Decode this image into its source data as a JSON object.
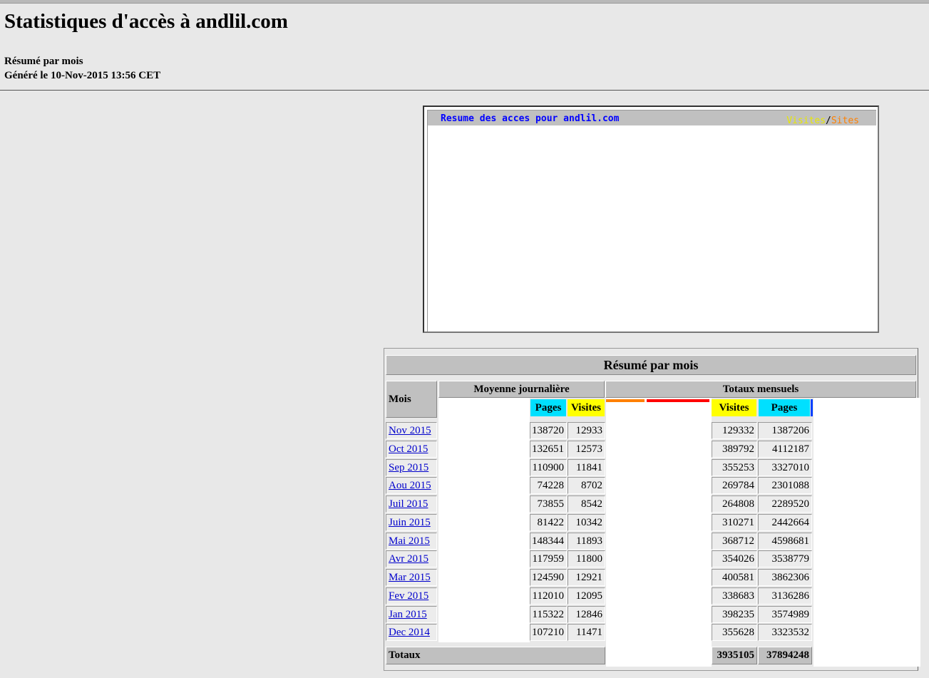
{
  "page": {
    "title": "Statistiques d'accès à andlil.com",
    "subtitle": "Résumé par mois",
    "generated": "Généré le 10-Nov-2015 13:56 CET"
  },
  "graph": {
    "title": "Resume des acces pour andlil.com",
    "legend_visits": "Visites",
    "legend_sep": "/",
    "legend_sites": "Sites"
  },
  "table": {
    "caption": "Résumé par mois",
    "col_month": "Mois",
    "group_daily": "Moyenne journalière",
    "group_monthly": "Totaux mensuels",
    "daily_pages": "Pages",
    "daily_visits": "Visites",
    "monthly_visits": "Visites",
    "monthly_pages": "Pages",
    "totals_label": "Totaux",
    "totals_visits": "3935105",
    "totals_pages": "37894248",
    "rows": [
      {
        "month": "Nov 2015",
        "d_pages": "138720",
        "d_visits": "12933",
        "m_visits": "129332",
        "m_pages": "1387206"
      },
      {
        "month": "Oct 2015",
        "d_pages": "132651",
        "d_visits": "12573",
        "m_visits": "389792",
        "m_pages": "4112187"
      },
      {
        "month": "Sep 2015",
        "d_pages": "110900",
        "d_visits": "11841",
        "m_visits": "355253",
        "m_pages": "3327010"
      },
      {
        "month": "Aou 2015",
        "d_pages": "74228",
        "d_visits": "8702",
        "m_visits": "269784",
        "m_pages": "2301088"
      },
      {
        "month": "Juil 2015",
        "d_pages": "73855",
        "d_visits": "8542",
        "m_visits": "264808",
        "m_pages": "2289520"
      },
      {
        "month": "Juin 2015",
        "d_pages": "81422",
        "d_visits": "10342",
        "m_visits": "310271",
        "m_pages": "2442664"
      },
      {
        "month": "Mai 2015",
        "d_pages": "148344",
        "d_visits": "11893",
        "m_visits": "368712",
        "m_pages": "4598681"
      },
      {
        "month": "Avr 2015",
        "d_pages": "117959",
        "d_visits": "11800",
        "m_visits": "354026",
        "m_pages": "3538779"
      },
      {
        "month": "Mar 2015",
        "d_pages": "124590",
        "d_visits": "12921",
        "m_visits": "400581",
        "m_pages": "3862306"
      },
      {
        "month": "Fev 2015",
        "d_pages": "112010",
        "d_visits": "12095",
        "m_visits": "338683",
        "m_pages": "3136286"
      },
      {
        "month": "Jan 2015",
        "d_pages": "115322",
        "d_visits": "12846",
        "m_visits": "398235",
        "m_pages": "3574989"
      },
      {
        "month": "Dec 2014",
        "d_pages": "107210",
        "d_visits": "11471",
        "m_visits": "355628",
        "m_pages": "3323532"
      }
    ]
  },
  "colors": {
    "link": "#0000cc",
    "pages_header": "#00e0ff",
    "visits_header": "#ffff00",
    "sites_strip": "#ff8000",
    "kbytes_strip": "#ff0000",
    "hits_strip": "#0040ff"
  }
}
